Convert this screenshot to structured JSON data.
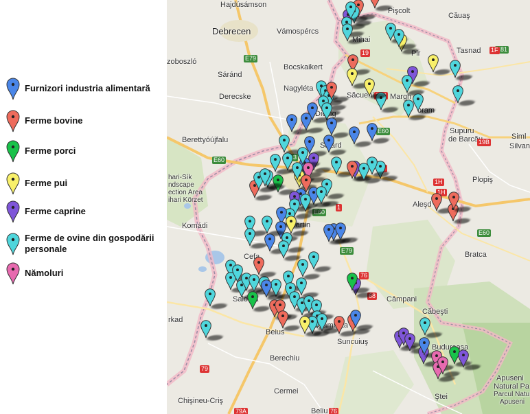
{
  "legend": {
    "items": [
      {
        "label": "Furnizori industria alimentară",
        "color": "#4a86e8"
      },
      {
        "label": "Ferme bovine",
        "color": "#ee6b5c"
      },
      {
        "label": "Ferme porci",
        "color": "#19c24a"
      },
      {
        "label": "Ferme pui",
        "color": "#f8f06a"
      },
      {
        "label": "Ferme caprine",
        "color": "#7f56d9"
      },
      {
        "label": "Ferme de ovine din gospodării personale",
        "color": "#4fd6dc"
      },
      {
        "label": "Nămoluri",
        "color": "#e76aaf"
      }
    ]
  },
  "map": {
    "places": [
      {
        "name": "Hajdúsámson",
        "cls": ""
      },
      {
        "name": "Pişcolt",
        "cls": ""
      },
      {
        "name": "Căuaş",
        "cls": ""
      },
      {
        "name": "Debrecen",
        "cls": "big"
      },
      {
        "name": "Vámospércs",
        "cls": ""
      },
      {
        "name": "Mihai",
        "cls": ""
      },
      {
        "name": "Pir",
        "cls": ""
      },
      {
        "name": "Tasnad",
        "cls": ""
      },
      {
        "name": "zoboszló",
        "cls": ""
      },
      {
        "name": "Sáránd",
        "cls": ""
      },
      {
        "name": "Bocskaikert",
        "cls": ""
      },
      {
        "name": "Nagyléta",
        "cls": ""
      },
      {
        "name": "Săcueni",
        "cls": ""
      },
      {
        "name": "Margh",
        "cls": ""
      },
      {
        "name": "oram",
        "cls": ""
      },
      {
        "name": "Derecske",
        "cls": ""
      },
      {
        "name": "Diosig",
        "cls": ""
      },
      {
        "name": "Supuru",
        "cls": ""
      },
      {
        "name": "de Barcău",
        "cls": ""
      },
      {
        "name": "Berettyóújfalu",
        "cls": ""
      },
      {
        "name": "Sălard",
        "cls": ""
      },
      {
        "name": "Siml",
        "cls": ""
      },
      {
        "name": "Silvan",
        "cls": ""
      },
      {
        "name": "hari-Sík",
        "cls": "small"
      },
      {
        "name": "ndscape",
        "cls": "small"
      },
      {
        "name": "ection Area",
        "cls": "small"
      },
      {
        "name": "ihari Körzet",
        "cls": "small"
      },
      {
        "name": "Plopiş",
        "cls": ""
      },
      {
        "name": "Aleşd",
        "cls": ""
      },
      {
        "name": "Komádi",
        "cls": ""
      },
      {
        "name": "Sînmartin",
        "cls": ""
      },
      {
        "name": "Cefa",
        "cls": ""
      },
      {
        "name": "Bratca",
        "cls": ""
      },
      {
        "name": "Câmpani",
        "cls": ""
      },
      {
        "name": "Căbeşti",
        "cls": ""
      },
      {
        "name": "Salonta",
        "cls": ""
      },
      {
        "name": "rkad",
        "cls": ""
      },
      {
        "name": "Beius",
        "cls": ""
      },
      {
        "name": "Sâmbăta",
        "cls": ""
      },
      {
        "name": "Suncuiuş",
        "cls": ""
      },
      {
        "name": "Budureasa",
        "cls": ""
      },
      {
        "name": "Berechiu",
        "cls": ""
      },
      {
        "name": "Apuseni",
        "cls": ""
      },
      {
        "name": "Natural Pa",
        "cls": ""
      },
      {
        "name": "Parcul Natural",
        "cls": "small"
      },
      {
        "name": "Apuseni",
        "cls": "small"
      },
      {
        "name": "Ştei",
        "cls": ""
      },
      {
        "name": "Chişineu-Criş",
        "cls": ""
      },
      {
        "name": "Cermei",
        "cls": ""
      },
      {
        "name": "Beliu",
        "cls": ""
      }
    ],
    "roads": [
      {
        "label": "E79",
        "cls": "e"
      },
      {
        "label": "E60",
        "cls": "e"
      },
      {
        "label": "A3",
        "cls": "e"
      },
      {
        "label": "E60",
        "cls": "e"
      },
      {
        "label": "E81",
        "cls": "e"
      },
      {
        "label": "E60",
        "cls": "e"
      },
      {
        "label": "E79",
        "cls": "e"
      },
      {
        "label": "E60",
        "cls": "e"
      },
      {
        "label": "19",
        "cls": "r"
      },
      {
        "label": "19B",
        "cls": "r"
      },
      {
        "label": "19B",
        "cls": "r"
      },
      {
        "label": "1F",
        "cls": "r"
      },
      {
        "label": "1P",
        "cls": "r"
      },
      {
        "label": "1H",
        "cls": "r"
      },
      {
        "label": "1H",
        "cls": "r"
      },
      {
        "label": "1",
        "cls": "r"
      },
      {
        "label": "76",
        "cls": "r"
      },
      {
        "label": "79",
        "cls": "r"
      },
      {
        "label": "76",
        "cls": "r"
      },
      {
        "label": "79A",
        "cls": "r"
      },
      {
        "label": "68",
        "cls": "r"
      }
    ],
    "markers": [
      {
        "t": 1
      },
      {
        "t": 1
      },
      {
        "t": 4
      },
      {
        "t": 5
      },
      {
        "t": 5
      },
      {
        "t": 5
      },
      {
        "t": 5
      },
      {
        "t": 1
      },
      {
        "t": 3
      },
      {
        "t": 5
      },
      {
        "t": 3
      },
      {
        "t": 5
      },
      {
        "t": 4
      },
      {
        "t": 3
      },
      {
        "t": 5
      },
      {
        "t": 5
      },
      {
        "t": 5
      },
      {
        "t": 5
      },
      {
        "t": 5
      },
      {
        "t": 1
      },
      {
        "t": 5
      },
      {
        "t": 5
      },
      {
        "t": 3
      },
      {
        "t": 5
      },
      {
        "t": 0
      },
      {
        "t": 0
      },
      {
        "t": 0
      },
      {
        "t": 0
      },
      {
        "t": 0
      },
      {
        "t": 0
      },
      {
        "t": 5
      },
      {
        "t": 5
      },
      {
        "t": 5
      },
      {
        "t": 0
      },
      {
        "t": 0
      },
      {
        "t": 4
      },
      {
        "t": 5
      },
      {
        "t": 0
      },
      {
        "t": 5
      },
      {
        "t": 5
      },
      {
        "t": 4
      },
      {
        "t": 5
      },
      {
        "t": 5
      },
      {
        "t": 5
      },
      {
        "t": 1
      },
      {
        "t": 2
      },
      {
        "t": 3
      },
      {
        "t": 5
      },
      {
        "t": 6
      },
      {
        "t": 1
      },
      {
        "t": 0
      },
      {
        "t": 0
      },
      {
        "t": 4
      },
      {
        "t": 5
      },
      {
        "t": 5
      },
      {
        "t": 5
      },
      {
        "t": 5
      },
      {
        "t": 5
      },
      {
        "t": 0
      },
      {
        "t": 0
      },
      {
        "t": 5
      },
      {
        "t": 5
      },
      {
        "t": 0
      },
      {
        "t": 1
      },
      {
        "t": 1
      },
      {
        "t": 1
      },
      {
        "t": 5
      },
      {
        "t": 5
      },
      {
        "t": 5
      },
      {
        "t": 0
      },
      {
        "t": 3
      },
      {
        "t": 5
      },
      {
        "t": 5
      },
      {
        "t": 0
      },
      {
        "t": 0
      },
      {
        "t": 5
      },
      {
        "t": 5
      },
      {
        "t": 5
      },
      {
        "t": 5
      },
      {
        "t": 5
      },
      {
        "t": 5
      },
      {
        "t": 5
      },
      {
        "t": 1
      },
      {
        "t": 5
      },
      {
        "t": 5
      },
      {
        "t": 5
      },
      {
        "t": 5
      },
      {
        "t": 5
      },
      {
        "t": 5
      },
      {
        "t": 0
      },
      {
        "t": 2
      },
      {
        "t": 4
      },
      {
        "t": 5
      },
      {
        "t": 5
      },
      {
        "t": 5
      },
      {
        "t": 5
      },
      {
        "t": 2
      },
      {
        "t": 1
      },
      {
        "t": 1
      },
      {
        "t": 1
      },
      {
        "t": 5
      },
      {
        "t": 5
      },
      {
        "t": 5
      },
      {
        "t": 3
      },
      {
        "t": 5
      },
      {
        "t": 5
      },
      {
        "t": 1
      },
      {
        "t": 0
      },
      {
        "t": 1
      },
      {
        "t": 4
      },
      {
        "t": 4
      },
      {
        "t": 4
      },
      {
        "t": 4
      },
      {
        "t": 0
      },
      {
        "t": 6
      },
      {
        "t": 6
      },
      {
        "t": 2
      },
      {
        "t": 4
      },
      {
        "t": 6
      },
      {
        "t": 5
      },
      {
        "t": 5
      },
      {
        "t": 5
      },
      {
        "t": 5
      },
      {
        "t": 1
      }
    ]
  }
}
